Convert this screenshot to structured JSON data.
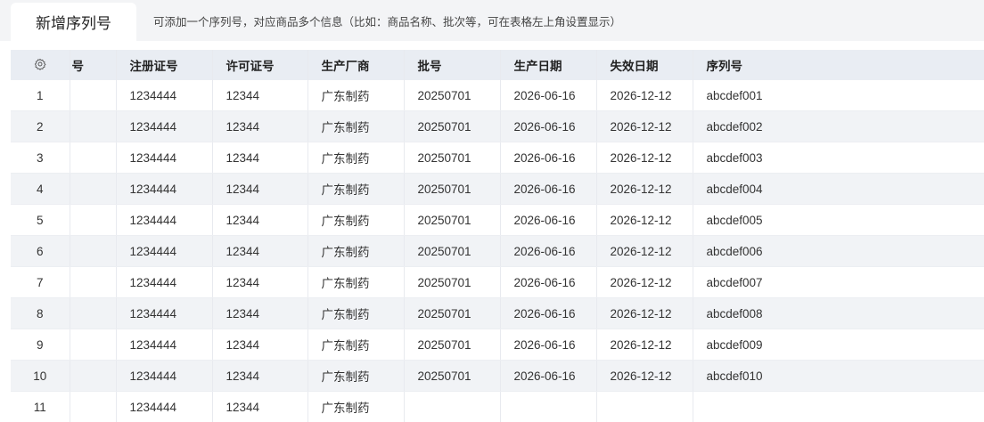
{
  "tab": {
    "title": "新增序列号"
  },
  "hint": "可添加一个序列号，对应商品多个信息（比如：商品名称、批次等，可在表格左上角设置显示）",
  "table": {
    "partial_header": "号",
    "headers": [
      "注册证号",
      "许可证号",
      "生产厂商",
      "批号",
      "生产日期",
      "失效日期",
      "序列号"
    ],
    "rows": [
      {
        "index": "1",
        "reg": "1234444",
        "lic": "12344",
        "maker": "广东制药",
        "batch": "20250701",
        "prod": "2026-06-16",
        "exp": "2026-12-12",
        "serial": "abcdef001"
      },
      {
        "index": "2",
        "reg": "1234444",
        "lic": "12344",
        "maker": "广东制药",
        "batch": "20250701",
        "prod": "2026-06-16",
        "exp": "2026-12-12",
        "serial": "abcdef002"
      },
      {
        "index": "3",
        "reg": "1234444",
        "lic": "12344",
        "maker": "广东制药",
        "batch": "20250701",
        "prod": "2026-06-16",
        "exp": "2026-12-12",
        "serial": "abcdef003"
      },
      {
        "index": "4",
        "reg": "1234444",
        "lic": "12344",
        "maker": "广东制药",
        "batch": "20250701",
        "prod": "2026-06-16",
        "exp": "2026-12-12",
        "serial": "abcdef004"
      },
      {
        "index": "5",
        "reg": "1234444",
        "lic": "12344",
        "maker": "广东制药",
        "batch": "20250701",
        "prod": "2026-06-16",
        "exp": "2026-12-12",
        "serial": "abcdef005"
      },
      {
        "index": "6",
        "reg": "1234444",
        "lic": "12344",
        "maker": "广东制药",
        "batch": "20250701",
        "prod": "2026-06-16",
        "exp": "2026-12-12",
        "serial": "abcdef006"
      },
      {
        "index": "7",
        "reg": "1234444",
        "lic": "12344",
        "maker": "广东制药",
        "batch": "20250701",
        "prod": "2026-06-16",
        "exp": "2026-12-12",
        "serial": "abcdef007"
      },
      {
        "index": "8",
        "reg": "1234444",
        "lic": "12344",
        "maker": "广东制药",
        "batch": "20250701",
        "prod": "2026-06-16",
        "exp": "2026-12-12",
        "serial": "abcdef008"
      },
      {
        "index": "9",
        "reg": "1234444",
        "lic": "12344",
        "maker": "广东制药",
        "batch": "20250701",
        "prod": "2026-06-16",
        "exp": "2026-12-12",
        "serial": "abcdef009"
      },
      {
        "index": "10",
        "reg": "1234444",
        "lic": "12344",
        "maker": "广东制药",
        "batch": "20250701",
        "prod": "2026-06-16",
        "exp": "2026-12-12",
        "serial": "abcdef010"
      },
      {
        "index": "11",
        "reg": "1234444",
        "lic": "12344",
        "maker": "广东制药",
        "batch": "",
        "prod": "",
        "exp": "",
        "serial": ""
      }
    ]
  }
}
